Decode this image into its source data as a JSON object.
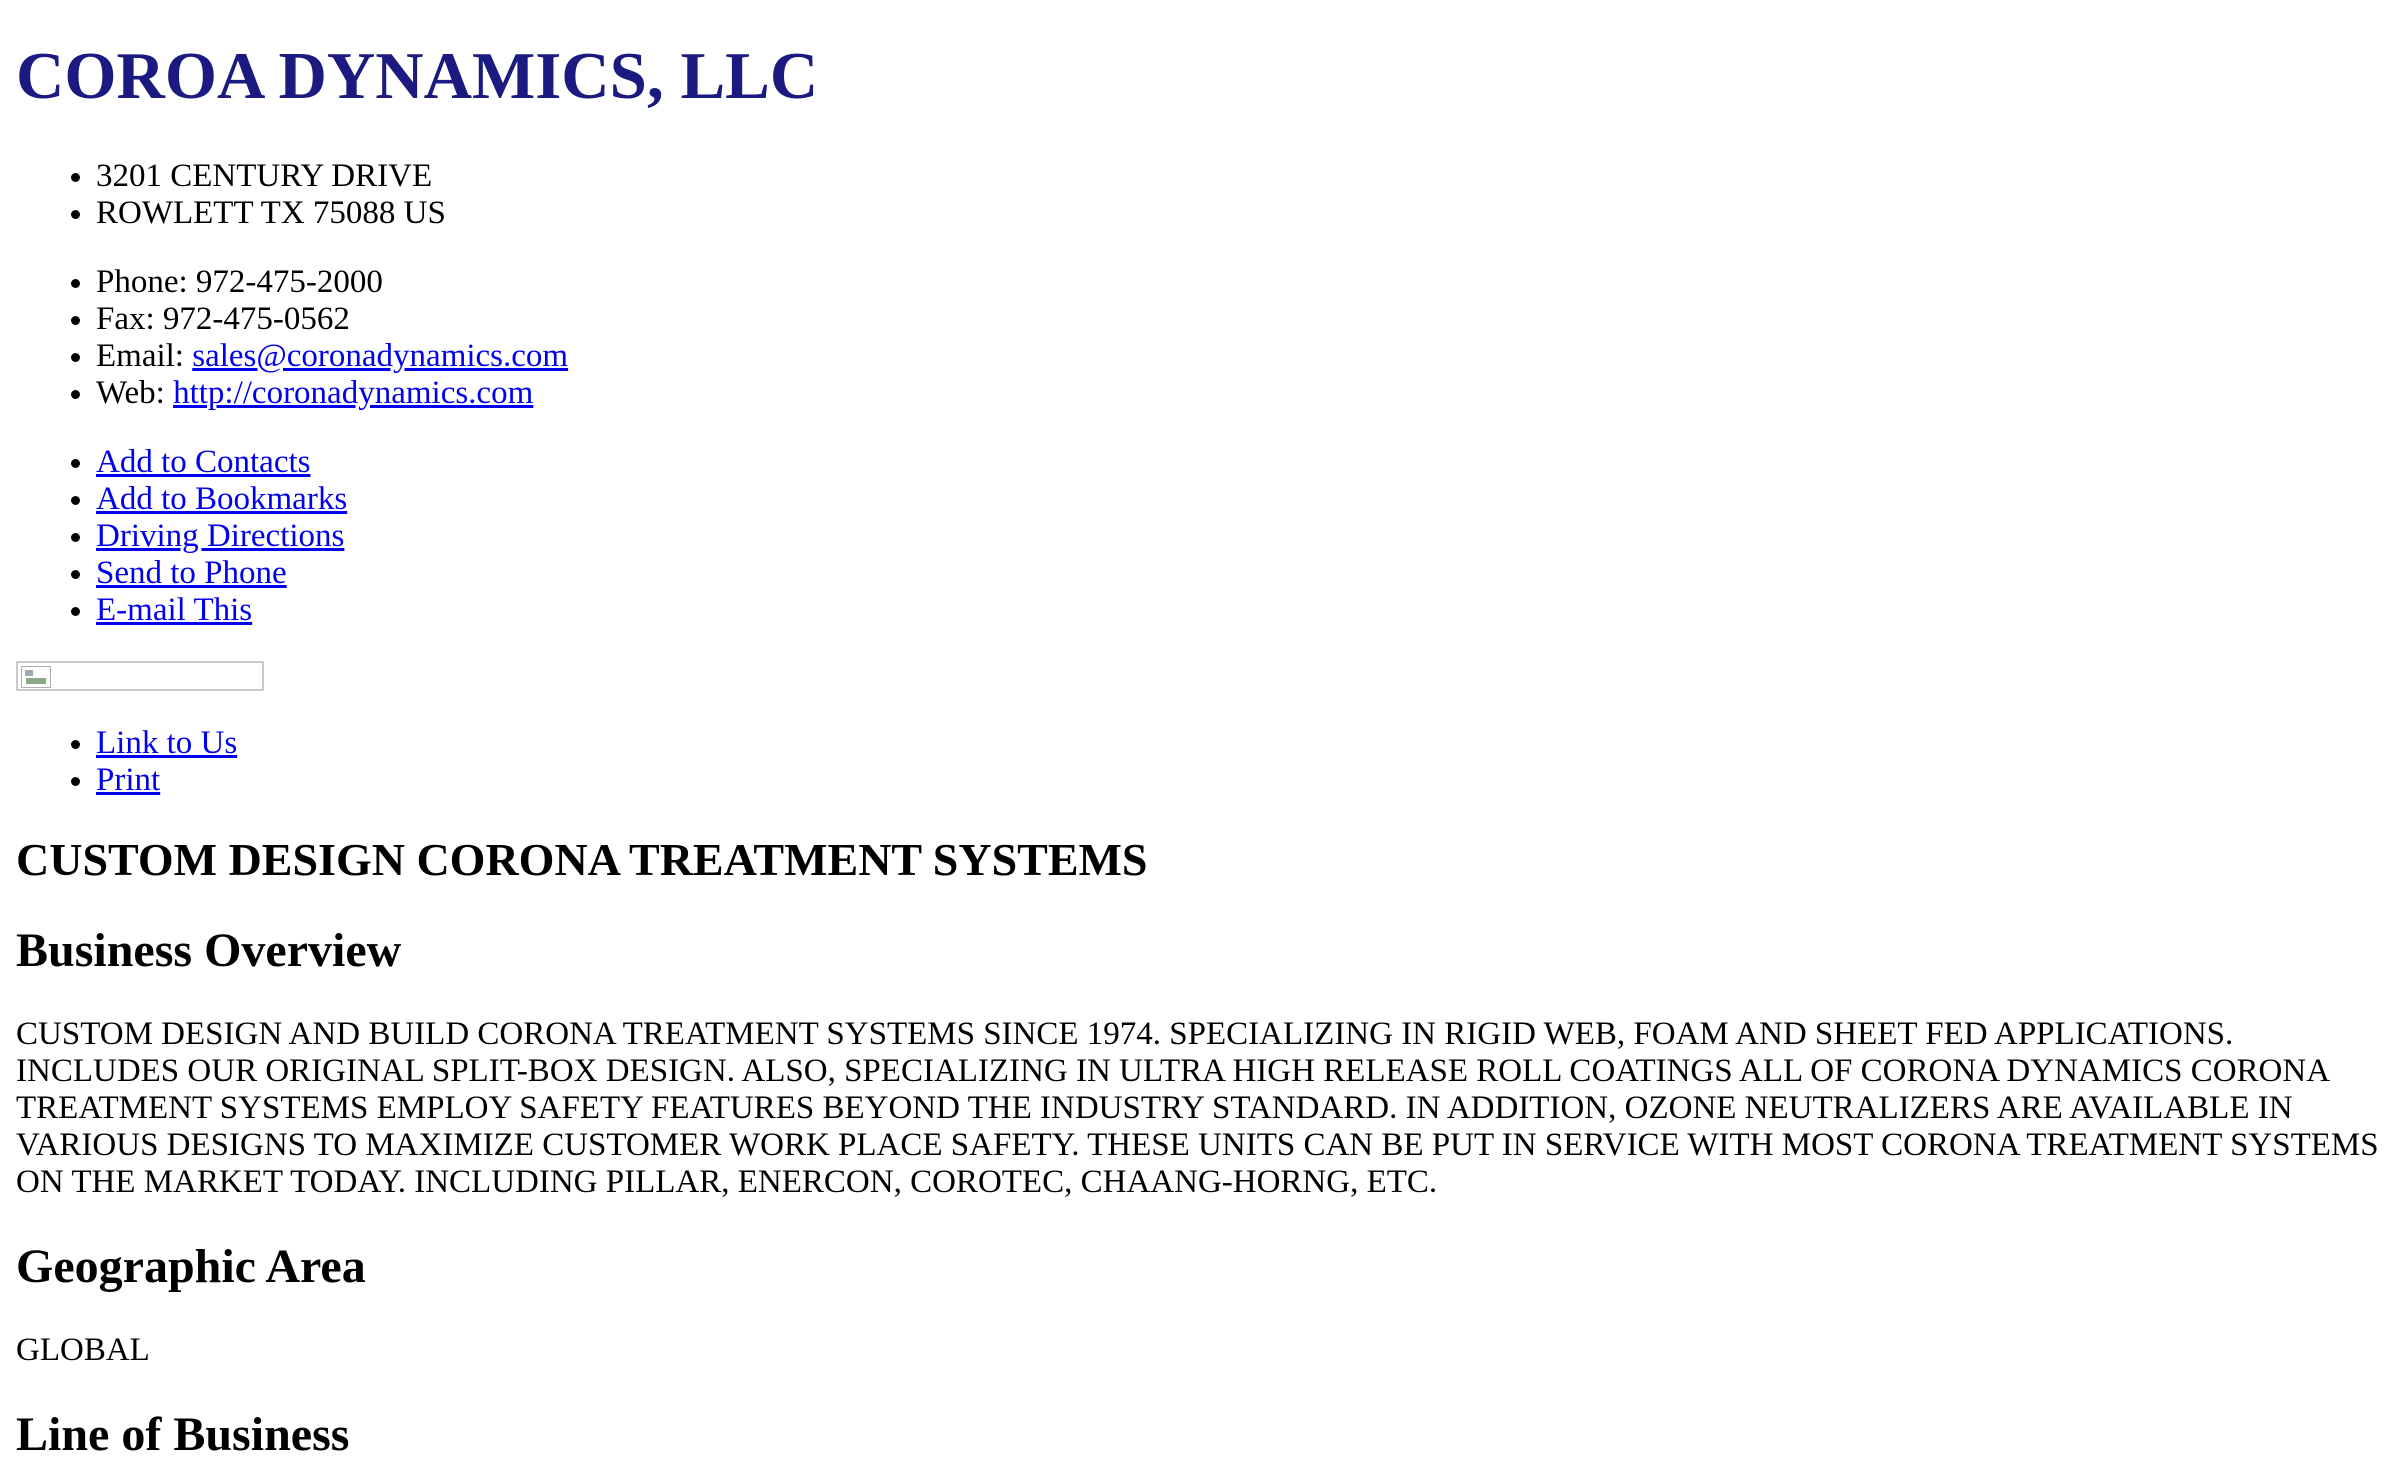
{
  "company": {
    "name": "COROA DYNAMICS, LLC"
  },
  "address": {
    "line1": "3201 CENTURY DRIVE",
    "line2": "ROWLETT TX 75088 US"
  },
  "contact": {
    "phone_label": "Phone: ",
    "phone": "972-475-2000",
    "fax_label": "Fax: ",
    "fax": "972-475-0562",
    "email_label": "Email: ",
    "email": "sales@coronadynamics.com",
    "web_label": "Web: ",
    "web": "http://coronadynamics.com"
  },
  "actions": [
    {
      "label": "Add to Contacts"
    },
    {
      "label": "Add to Bookmarks"
    },
    {
      "label": "Driving Directions"
    },
    {
      "label": "Send to Phone"
    },
    {
      "label": "E-mail This"
    }
  ],
  "share": [
    {
      "label": "Link to Us"
    },
    {
      "label": "Print"
    }
  ],
  "tagline": "CUSTOM DESIGN CORONA TREATMENT SYSTEMS",
  "sections": {
    "overview_title": "Business Overview",
    "overview_text": "CUSTOM DESIGN AND BUILD CORONA TREATMENT SYSTEMS SINCE 1974. SPECIALIZING IN RIGID WEB, FOAM AND SHEET FED APPLICATIONS. INCLUDES OUR ORIGINAL SPLIT-BOX DESIGN. ALSO, SPECIALIZING IN ULTRA HIGH RELEASE ROLL COATINGS ALL OF CORONA DYNAMICS CORONA TREATMENT SYSTEMS EMPLOY SAFETY FEATURES BEYOND THE INDUSTRY STANDARD. IN ADDITION, OZONE NEUTRALIZERS ARE AVAILABLE IN VARIOUS DESIGNS TO MAXIMIZE CUSTOMER WORK PLACE SAFETY. THESE UNITS CAN BE PUT IN SERVICE WITH MOST CORONA TREATMENT SYSTEMS ON THE MARKET TODAY. INCLUDING PILLAR, ENERCON, COROTEC, CHAANG-HORNG, ETC.",
    "geo_title": "Geographic Area",
    "geo_text": "GLOBAL",
    "lob_title": "Line of Business"
  },
  "colors": {
    "company_name": "#1a1a80",
    "link": "#0000ee"
  }
}
